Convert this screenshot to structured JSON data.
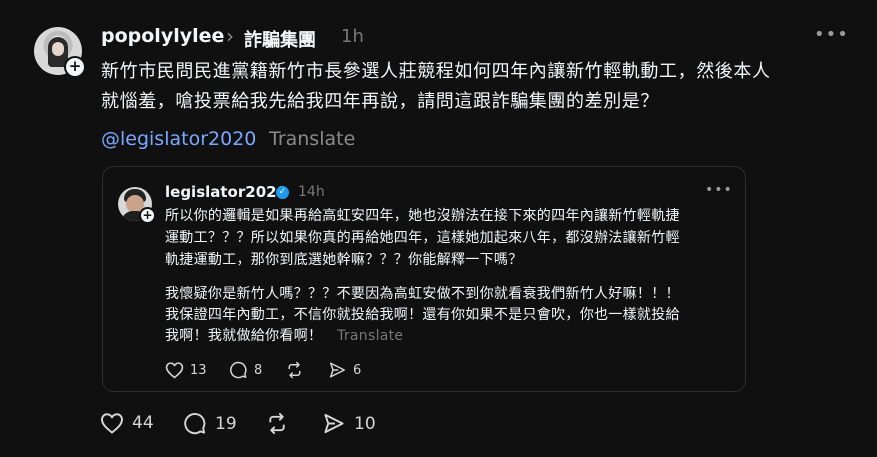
{
  "post": {
    "username": "popolylylee",
    "group": "詐騙集團",
    "time": "1h",
    "text_line1": "新竹市民問民進黨籍新竹市長參選人莊競程如何四年內讓新竹輕軌動工，然後本人",
    "text_line2": "就惱羞，嗆投票給我先給我四年再說，請問這跟詐騙集團的差別是？",
    "mention": "@legislator2020",
    "translate": "Translate",
    "stats": {
      "likes": "44",
      "comments": "19",
      "shares": "10"
    }
  },
  "quote": {
    "username": "legislator2020",
    "time": "14h",
    "p1_l1": "所以你的邏輯是如果再給高虹安四年，她也沒辦法在接下來的四年內讓新竹輕軌捷",
    "p1_l2": "運動工？？？所以如果你真的再給她四年，這樣她加起來八年，都沒辦法讓新竹輕",
    "p1_l3": "軌捷運動工，那你到底選她幹嘛？？？你能解釋一下嗎？",
    "p2_l1": "我懷疑你是新竹人嗎？？？不要因為高虹安做不到你就看衰我們新竹人好嘛！！！",
    "p2_l2": "我保證四年內動工，不信你就投給我啊！還有你如果不是只會吹，你也一樣就投給",
    "p2_l3": "我啊！我就做給你看啊！",
    "translate": "Translate",
    "stats": {
      "likes": "13",
      "comments": "8",
      "shares": "6"
    }
  },
  "icons": [
    "heart-icon",
    "comment-icon",
    "repost-icon",
    "share-icon",
    "more-icon",
    "chevron-right-icon",
    "verified-icon",
    "follow-plus-icon"
  ]
}
